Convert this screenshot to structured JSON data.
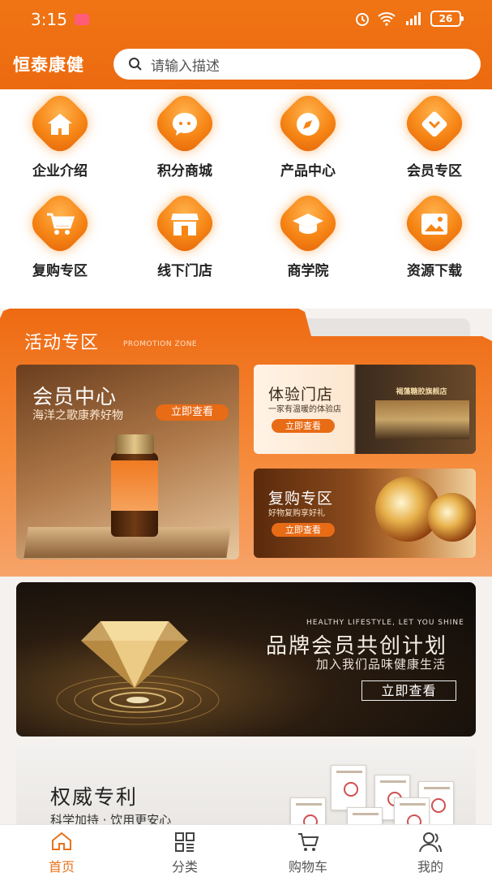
{
  "status": {
    "time": "3:15",
    "battery": "26"
  },
  "header": {
    "brand": "恒泰康健",
    "search_placeholder": "请输入描述"
  },
  "grid": [
    {
      "label": "企业介绍",
      "icon": "home-icon"
    },
    {
      "label": "积分商城",
      "icon": "chat-icon"
    },
    {
      "label": "产品中心",
      "icon": "compass-icon"
    },
    {
      "label": "会员专区",
      "icon": "chevron-down-icon"
    },
    {
      "label": "复购专区",
      "icon": "cart-icon"
    },
    {
      "label": "线下门店",
      "icon": "store-icon"
    },
    {
      "label": "商学院",
      "icon": "graduation-cap-icon"
    },
    {
      "label": "资源下载",
      "icon": "image-icon"
    }
  ],
  "promo": {
    "title": "活动专区",
    "subtitle": "PROMOTION ZONE",
    "member_card": {
      "title": "会员中心",
      "subtitle": "海洋之歌康养好物",
      "button": "立即查看"
    },
    "store_card": {
      "title": "体验门店",
      "subtitle": "一家有温暖的体验店",
      "button": "立即查看",
      "sign": "褐藻糖胶旗舰店"
    },
    "repurchase_card": {
      "title": "复购专区",
      "subtitle": "好物复购享好礼",
      "button": "立即查看"
    }
  },
  "banner": {
    "english": "HEALTHY LIFESTYLE, LET YOU SHINE",
    "title": "品牌会员共创计划",
    "subtitle": "加入我们品味健康生活",
    "button": "立即查看"
  },
  "patent": {
    "title": "权威专利",
    "subtitle": "科学加持 · 饮用更安心"
  },
  "bottom_nav": [
    {
      "label": "首页",
      "icon": "home-outline-icon",
      "active": true
    },
    {
      "label": "分类",
      "icon": "grid-icon",
      "active": false
    },
    {
      "label": "购物车",
      "icon": "cart-outline-icon",
      "active": false
    },
    {
      "label": "我的",
      "icon": "user-icon",
      "active": false
    }
  ],
  "colors": {
    "primary": "#ec6a10",
    "active_nav": "#e8731a"
  }
}
